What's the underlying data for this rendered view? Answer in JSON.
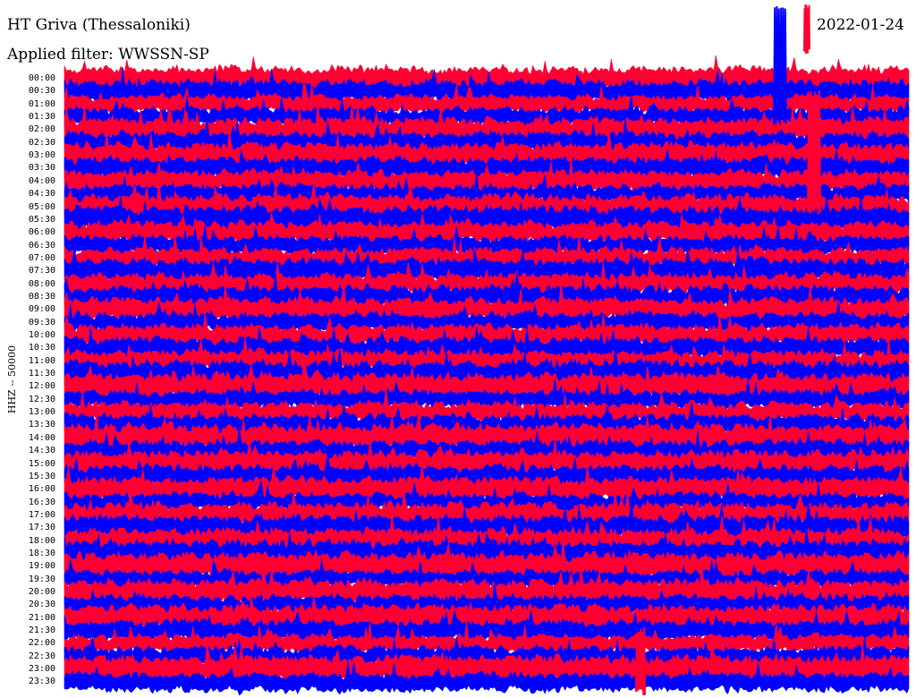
{
  "header": {
    "station": "HT Griva (Thessaloniki)",
    "date": "2022-01-24",
    "filter": "Applied filter: WWSSN-SP"
  },
  "channel_label": "HHZ -- 50000",
  "colors": {
    "trace_a": "#0000ff",
    "trace_b": "#ff0033",
    "background": "#ffffff",
    "text": "#000000"
  },
  "chart_data": {
    "type": "line",
    "title": "HT Griva (Thessaloniki)",
    "subtitle": "Applied filter: WWSSN-SP",
    "ylabel": "HHZ -- 50000",
    "date": "2022-01-24",
    "row_labels": [
      "00:00",
      "00:30",
      "01:00",
      "01:30",
      "02:00",
      "02:30",
      "03:00",
      "03:30",
      "04:00",
      "04:30",
      "05:00",
      "05:30",
      "06:00",
      "06:30",
      "07:00",
      "07:30",
      "08:00",
      "08:30",
      "09:00",
      "09:30",
      "10:00",
      "10:30",
      "11:00",
      "11:30",
      "12:00",
      "12:30",
      "13:00",
      "13:30",
      "14:00",
      "14:30",
      "15:00",
      "15:30",
      "16:00",
      "16:30",
      "17:00",
      "17:30",
      "18:00",
      "18:30",
      "19:00",
      "19:30",
      "20:00",
      "20:30",
      "21:00",
      "21:30",
      "22:00",
      "22:30",
      "23:00",
      "23:30"
    ],
    "row_colors": [
      "#ff0033",
      "#0000ff"
    ],
    "grid": false,
    "legend": "none"
  }
}
